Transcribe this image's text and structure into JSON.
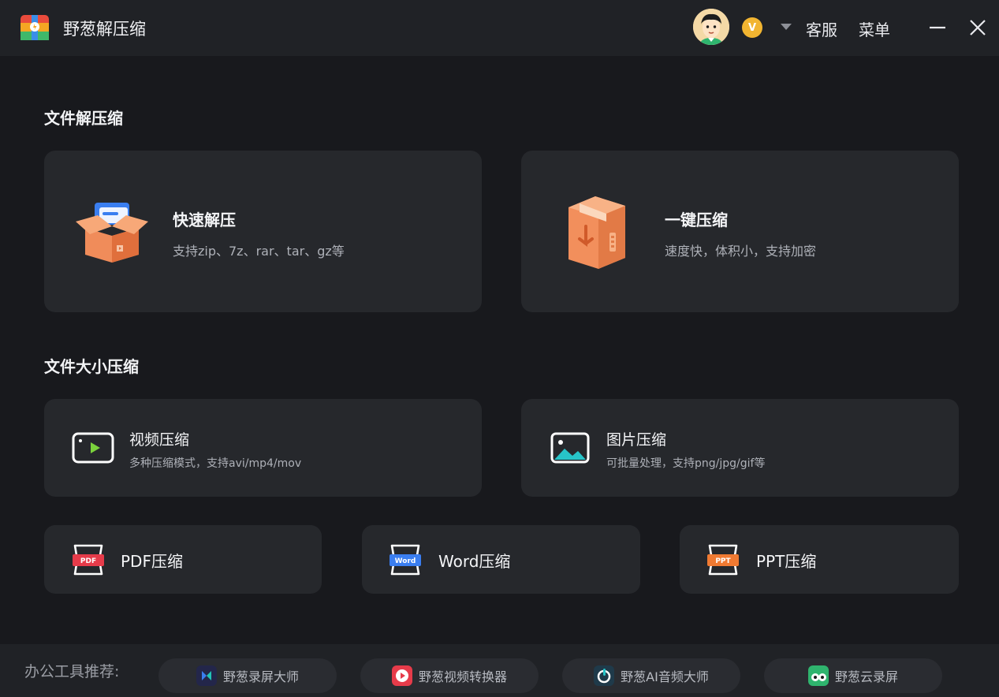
{
  "app": {
    "title": "野葱解压缩"
  },
  "header": {
    "vip_label": "V",
    "service_label": "客服",
    "menu_label": "菜单"
  },
  "sections": {
    "decompress_title": "文件解压缩",
    "size_title": "文件大小压缩"
  },
  "cards": {
    "quick_extract": {
      "title": "快速解压",
      "subtitle": "支持zip、7z、rar、tar、gz等"
    },
    "one_click": {
      "title": "一键压缩",
      "subtitle": "速度快，体积小，支持加密"
    },
    "video": {
      "title": "视频压缩",
      "subtitle": "多种压缩模式，支持avi/mp4/mov"
    },
    "image": {
      "title": "图片压缩",
      "subtitle": "可批量处理，支持png/jpg/gif等"
    },
    "pdf": {
      "title": "PDF压缩",
      "badge": "PDF"
    },
    "word": {
      "title": "Word压缩",
      "badge": "Word"
    },
    "ppt": {
      "title": "PPT压缩",
      "badge": "PPT"
    }
  },
  "footer": {
    "label": "办公工具推荐:",
    "tools": [
      {
        "name": "野葱录屏大师"
      },
      {
        "name": "野葱视频转换器"
      },
      {
        "name": "野葱AI音频大师"
      },
      {
        "name": "野葱云录屏"
      }
    ]
  },
  "colors": {
    "background": "#18191d",
    "card": "#26282c",
    "titlebar": "#202226",
    "vip": "#f2b531",
    "pdf_red": "#e63b4a",
    "word_blue": "#3a7ef0",
    "ppt_orange": "#f07a32"
  }
}
